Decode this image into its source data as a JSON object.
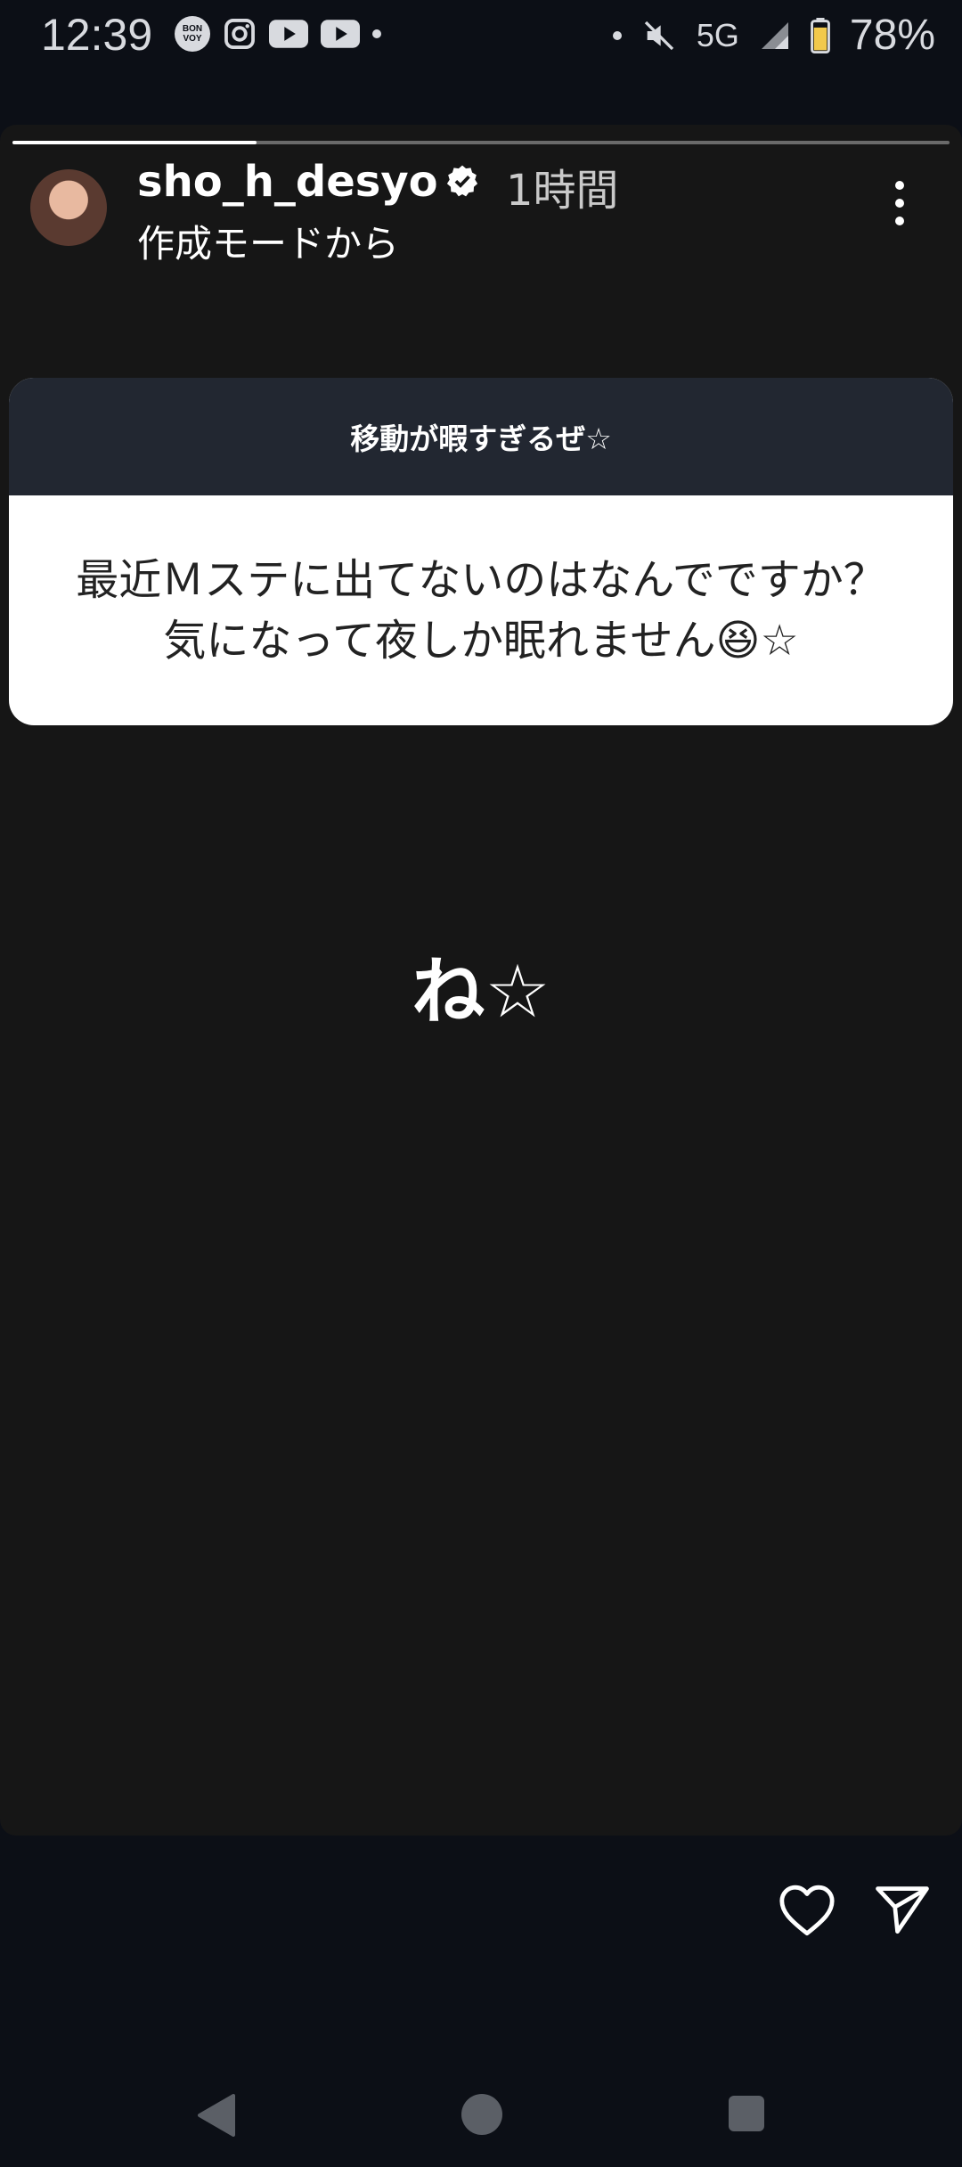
{
  "status_bar": {
    "time": "12:39",
    "notification_icons": [
      "bonvoy-icon",
      "instagram-icon",
      "youtube-icon",
      "youtube-icon"
    ],
    "bonvoy_text": "BON VOY",
    "network": "5G",
    "battery": "78%"
  },
  "story": {
    "progress_fraction": 0.26,
    "username": "sho_h_desyo",
    "verified": true,
    "time_ago": "1時間",
    "subtitle": "作成モードから",
    "question_card": {
      "header": "移動が暇すぎるぜ☆",
      "question": "最近Ｍステに出てないのはなんでですか？気になって夜しか眠れません😆☆"
    },
    "answer_text": "ね☆"
  },
  "actions": [
    "heart-icon",
    "send-icon"
  ],
  "nav": [
    "back",
    "home",
    "recents"
  ],
  "colors": {
    "background": "#0c0f16",
    "story_bg": "#161616",
    "card_head": "#222731",
    "card_body": "#ffffff"
  }
}
